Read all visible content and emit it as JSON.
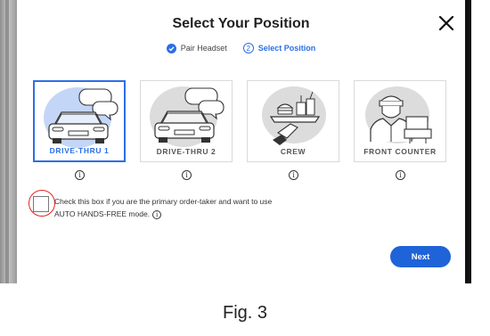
{
  "header": {
    "title": "Select Your Position",
    "close_icon": "close-icon"
  },
  "steps": [
    {
      "label": "Pair Headset",
      "state": "done",
      "icon": "check-circle-icon"
    },
    {
      "label": "Select Position",
      "state": "active",
      "number": "2"
    }
  ],
  "positions": [
    {
      "label": "DRIVE-THRU 1",
      "selected": true,
      "icon": "car-speech-icon"
    },
    {
      "label": "DRIVE-THRU 2",
      "selected": false,
      "icon": "car-speech-icon"
    },
    {
      "label": "CREW",
      "selected": false,
      "icon": "crew-tray-icon"
    },
    {
      "label": "FRONT COUNTER",
      "selected": false,
      "icon": "counter-register-icon"
    }
  ],
  "info_glyph": "i",
  "checkbox": {
    "line1": "Check this box if you are the primary order-taker and want to use",
    "line2": "AUTO HANDS-FREE mode.",
    "checked": false
  },
  "next_label": "Next",
  "caption": "Fig. 3",
  "colors": {
    "accent": "#2c6ee8",
    "button": "#1f63d8",
    "highlight_ring": "#e0261e"
  }
}
